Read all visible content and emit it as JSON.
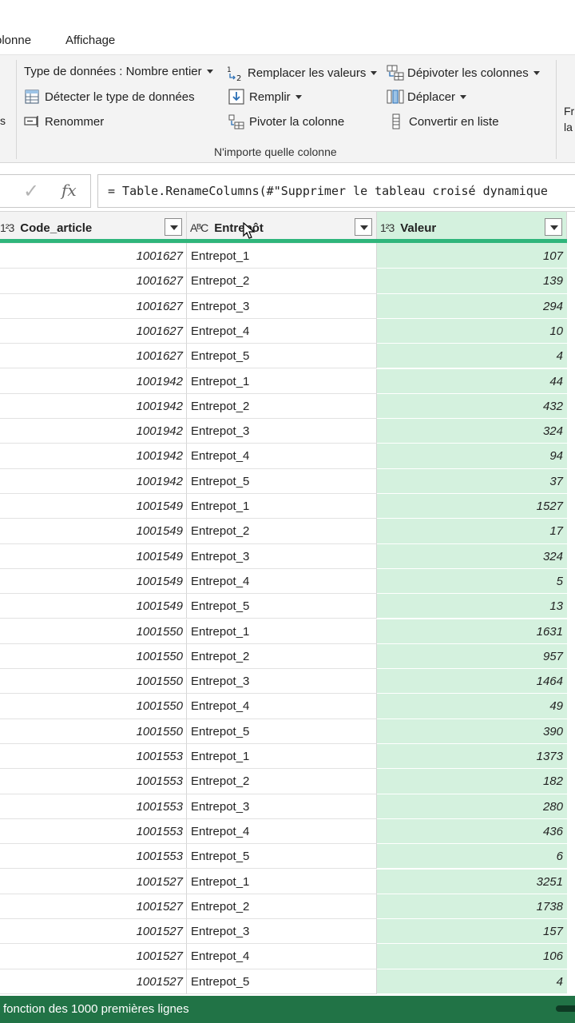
{
  "tabs": [
    {
      "label": "olonne"
    },
    {
      "label": "Affichage"
    }
  ],
  "ribbon": {
    "data_type": "Type de données : Nombre entier",
    "detect_type": "Détecter le type de données",
    "rename": "Renommer",
    "replace_values": "Remplacer les valeurs",
    "fill": "Remplir",
    "pivot": "Pivoter la colonne",
    "unpivot": "Dépivoter les colonnes",
    "move": "Déplacer",
    "convert_list": "Convertir en liste",
    "group_label": "N'importe quelle colonne",
    "left_edge": "s",
    "right_edge_1": "Fr",
    "right_edge_2": "la"
  },
  "formula_bar": {
    "check": "✓",
    "fx": "fx",
    "formula": "= Table.RenameColumns(#\"Supprimer le tableau croisé dynamique"
  },
  "columns": [
    {
      "type_icon": "1²3",
      "name": "Code_article"
    },
    {
      "type_icon": "AᴮC",
      "name": "Entrepôt"
    },
    {
      "type_icon": "1²3",
      "name": "Valeur"
    }
  ],
  "rows": [
    {
      "code": "1001627",
      "entrepot": "Entrepot_1",
      "valeur": "107"
    },
    {
      "code": "1001627",
      "entrepot": "Entrepot_2",
      "valeur": "139"
    },
    {
      "code": "1001627",
      "entrepot": "Entrepot_3",
      "valeur": "294"
    },
    {
      "code": "1001627",
      "entrepot": "Entrepot_4",
      "valeur": "10"
    },
    {
      "code": "1001627",
      "entrepot": "Entrepot_5",
      "valeur": "4"
    },
    {
      "code": "1001942",
      "entrepot": "Entrepot_1",
      "valeur": "44"
    },
    {
      "code": "1001942",
      "entrepot": "Entrepot_2",
      "valeur": "432"
    },
    {
      "code": "1001942",
      "entrepot": "Entrepot_3",
      "valeur": "324"
    },
    {
      "code": "1001942",
      "entrepot": "Entrepot_4",
      "valeur": "94"
    },
    {
      "code": "1001942",
      "entrepot": "Entrepot_5",
      "valeur": "37"
    },
    {
      "code": "1001549",
      "entrepot": "Entrepot_1",
      "valeur": "1527"
    },
    {
      "code": "1001549",
      "entrepot": "Entrepot_2",
      "valeur": "17"
    },
    {
      "code": "1001549",
      "entrepot": "Entrepot_3",
      "valeur": "324"
    },
    {
      "code": "1001549",
      "entrepot": "Entrepot_4",
      "valeur": "5"
    },
    {
      "code": "1001549",
      "entrepot": "Entrepot_5",
      "valeur": "13"
    },
    {
      "code": "1001550",
      "entrepot": "Entrepot_1",
      "valeur": "1631"
    },
    {
      "code": "1001550",
      "entrepot": "Entrepot_2",
      "valeur": "957"
    },
    {
      "code": "1001550",
      "entrepot": "Entrepot_3",
      "valeur": "1464"
    },
    {
      "code": "1001550",
      "entrepot": "Entrepot_4",
      "valeur": "49"
    },
    {
      "code": "1001550",
      "entrepot": "Entrepot_5",
      "valeur": "390"
    },
    {
      "code": "1001553",
      "entrepot": "Entrepot_1",
      "valeur": "1373"
    },
    {
      "code": "1001553",
      "entrepot": "Entrepot_2",
      "valeur": "182"
    },
    {
      "code": "1001553",
      "entrepot": "Entrepot_3",
      "valeur": "280"
    },
    {
      "code": "1001553",
      "entrepot": "Entrepot_4",
      "valeur": "436"
    },
    {
      "code": "1001553",
      "entrepot": "Entrepot_5",
      "valeur": "6"
    },
    {
      "code": "1001527",
      "entrepot": "Entrepot_1",
      "valeur": "3251"
    },
    {
      "code": "1001527",
      "entrepot": "Entrepot_2",
      "valeur": "1738"
    },
    {
      "code": "1001527",
      "entrepot": "Entrepot_3",
      "valeur": "157"
    },
    {
      "code": "1001527",
      "entrepot": "Entrepot_4",
      "valeur": "106"
    },
    {
      "code": "1001527",
      "entrepot": "Entrepot_5",
      "valeur": "4"
    }
  ],
  "status_bar": {
    "text": "fonction des 1000 premières lignes"
  },
  "colors": {
    "accent": "#2fb57b",
    "selected_column": "#d4f1de",
    "status_bar": "#217346"
  }
}
